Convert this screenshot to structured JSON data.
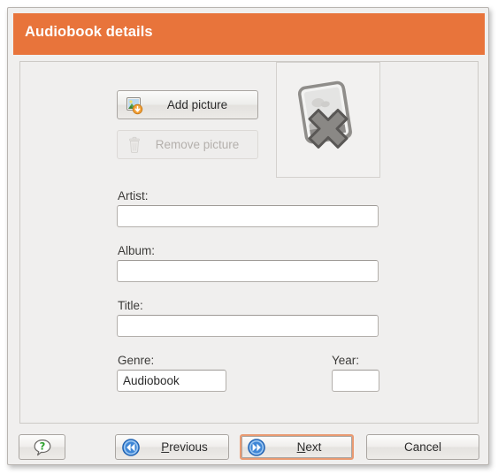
{
  "window": {
    "title": "Audiobook details",
    "header_color": "#e8743b",
    "background_color": "#f0efee"
  },
  "picture": {
    "add_label": "Add picture",
    "add_icon": "add-picture-icon",
    "remove_label": "Remove picture",
    "remove_icon": "trash-icon",
    "remove_enabled": false,
    "preview_icon": "image-missing-icon",
    "preview_state": "no image"
  },
  "form": {
    "artist": {
      "label": "Artist:",
      "value": "",
      "placeholder": ""
    },
    "album": {
      "label": "Album:",
      "value": "",
      "placeholder": ""
    },
    "title": {
      "label": "Title:",
      "value": "",
      "placeholder": ""
    },
    "genre": {
      "label": "Genre:",
      "value": "Audiobook",
      "placeholder": ""
    },
    "year": {
      "label": "Year:",
      "value": "",
      "placeholder": ""
    }
  },
  "actions": {
    "help_icon": "help-question-icon",
    "previous": {
      "label_before": "",
      "mnemonic": "P",
      "label_after": "revious",
      "icon": "back-arrow-icon"
    },
    "next": {
      "label_before": "",
      "mnemonic": "N",
      "label_after": "ext",
      "icon": "forward-arrow-icon",
      "is_default": true,
      "focus_color": "#e99a72"
    },
    "cancel": {
      "label": "Cancel"
    }
  }
}
